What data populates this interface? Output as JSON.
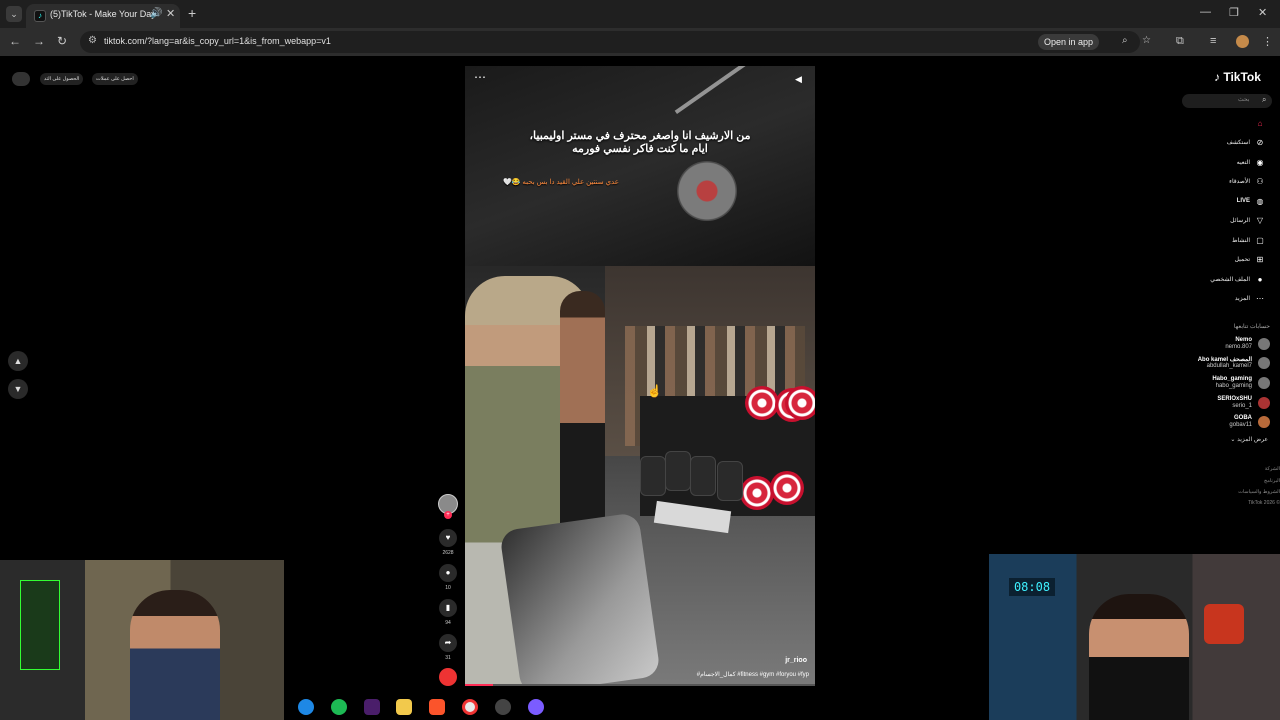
{
  "browser": {
    "tab_title": "(5)TikTok - Make Your Day",
    "url": "tiktok.com/?lang=ar&is_copy_url=1&is_from_webapp=v1",
    "open_in_app": "Open in app"
  },
  "top_left": {
    "pill1": "الحصول على التد",
    "pill2": "احصل على عملات"
  },
  "video": {
    "caption": "من الارشيف انا واصغر محترف في مستر اوليمبيا، ايام ما كنت فاكر نفسي فورمه",
    "subcaption": "عدي سنتين علي القيد دا بس بحبه 😂🤍",
    "username": "jr_rioo",
    "hashtags": "#كمال_الاجسام #fitness #gym #foryou #fyp",
    "progress_fraction": 0.08
  },
  "actions": {
    "likes": "2628",
    "comments": "10",
    "saves": "94",
    "shares": "31"
  },
  "sidebar": {
    "logo": "TikTok",
    "search_placeholder": "بحث",
    "items": [
      {
        "label": "",
        "icon": "home-icon"
      },
      {
        "label": "استكشف",
        "icon": "explore-icon"
      },
      {
        "label": "التعيه",
        "icon": "following-icon"
      },
      {
        "label": "الأصدقاء",
        "icon": "friends-icon"
      },
      {
        "label": "LIVE",
        "icon": "live-icon"
      },
      {
        "label": "الرسائل",
        "icon": "messages-icon"
      },
      {
        "label": "النشاط",
        "icon": "activity-icon"
      },
      {
        "label": "تحميل",
        "icon": "upload-icon"
      },
      {
        "label": "الملف الشخصي",
        "icon": "profile-icon"
      },
      {
        "label": "المزيد",
        "icon": "more-icon"
      }
    ],
    "following_title": "حسابات تتابعها",
    "accounts": [
      {
        "name": "Nemo",
        "handle": "nemo.807"
      },
      {
        "name": "Abo kamel المصحف",
        "handle": "abdullah_kamel7"
      },
      {
        "name": "Habo_gaming",
        "handle": "habo_gaming"
      },
      {
        "name": "SERIOxSHU",
        "handle": "serio_1"
      },
      {
        "name": "GOBA",
        "handle": "gobav11"
      }
    ],
    "see_more": "عرض المزيد",
    "footer": [
      "الشركة",
      "البرنامج",
      "الشروط والسياسات",
      "TikTok 2026 ©"
    ]
  },
  "webcam": {
    "clock_text": "08:08"
  },
  "colors": {
    "accent": "#fe2c55",
    "cyan": "#25f4ee"
  }
}
